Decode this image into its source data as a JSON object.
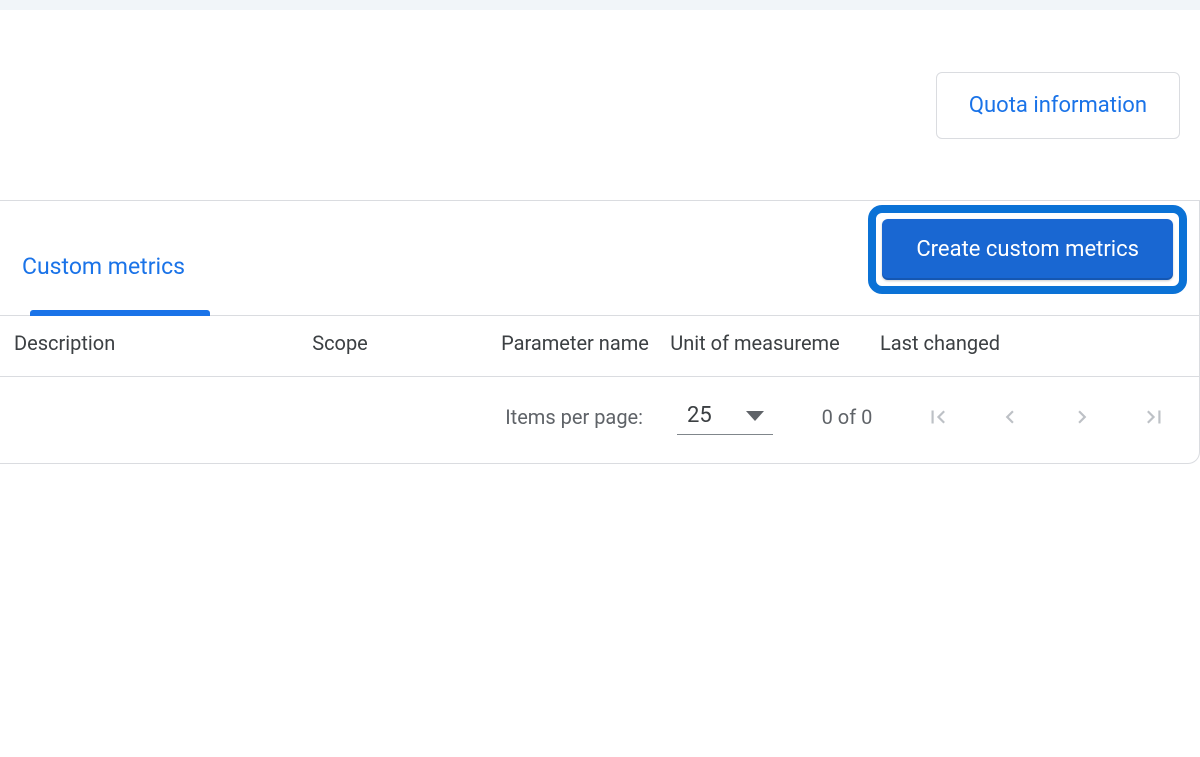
{
  "topbar": {
    "quota_label": "Quota information"
  },
  "panel": {
    "tab_label": "Custom metrics",
    "create_label": "Create custom metrics"
  },
  "table": {
    "headers": {
      "description": "Description",
      "scope": "Scope",
      "parameter_name": "Parameter name",
      "unit": "Unit of measureme",
      "last_changed": "Last changed"
    }
  },
  "pagination": {
    "items_per_page_label": "Items per page:",
    "page_size": "25",
    "range_text": "0 of 0"
  }
}
